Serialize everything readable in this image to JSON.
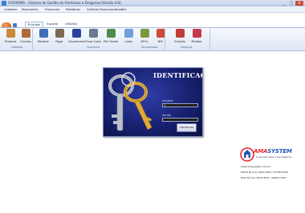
{
  "window": {
    "title": "SYSFARMA - Sistema de Gestão de Farmácias e Drogarias [Versão 4.8]",
    "controls": [
      "_",
      "□",
      "×"
    ]
  },
  "menu": [
    "Cadastro",
    "Movimento",
    "Financeiro",
    "Relatórios",
    "Gráficos Demonstrativos",
    "Sair"
  ],
  "tabs": [
    "Principal",
    "Suporte",
    "Utilitário"
  ],
  "ribbon": {
    "groups": [
      "Cadastro",
      "Financeiro",
      "Faturamento",
      "Compras"
    ],
    "buttons": [
      {
        "label": "Produtos",
        "color": "#c98a3a"
      },
      {
        "label": "Clientes",
        "color": "#b06a3c"
      },
      {
        "label": "Receber",
        "color": "#3d6fb8"
      },
      {
        "label": "Pagar",
        "color": "#7a6b55"
      },
      {
        "label": "Orçamentos",
        "color": "#27449a"
      },
      {
        "label": "Fluxo Caixa",
        "color": "#6b7a8f"
      },
      {
        "label": "PdV Venda",
        "color": "#4e8a4a"
      },
      {
        "label": "Caixa",
        "color": "#6da0d8"
      },
      {
        "label": "NFCe",
        "color": "#7a9a3a"
      },
      {
        "label": "NFe",
        "color": "#d04a3a"
      },
      {
        "label": "Entrada",
        "color": "#c23a3a"
      },
      {
        "label": "Pedidos",
        "color": "#c33a4a"
      }
    ]
  },
  "login": {
    "title": "IDENTIFICAÇÃO",
    "user_label": "Usuário",
    "user_value": "1",
    "password_label": "Senha",
    "password_value": "",
    "confirm_label": "Confirmar"
  },
  "brand": {
    "name_part1": "AMA",
    "name_part2": "SYSTEM",
    "tagline": "A solução para o seu Negócio",
    "site": "www.amasystem.com.br",
    "line1": "Matriz RJ  (21) 2464-2458 / 97336-5040",
    "line2": "Filial  SP  (11) 3020-4521 / 96093-3097"
  }
}
